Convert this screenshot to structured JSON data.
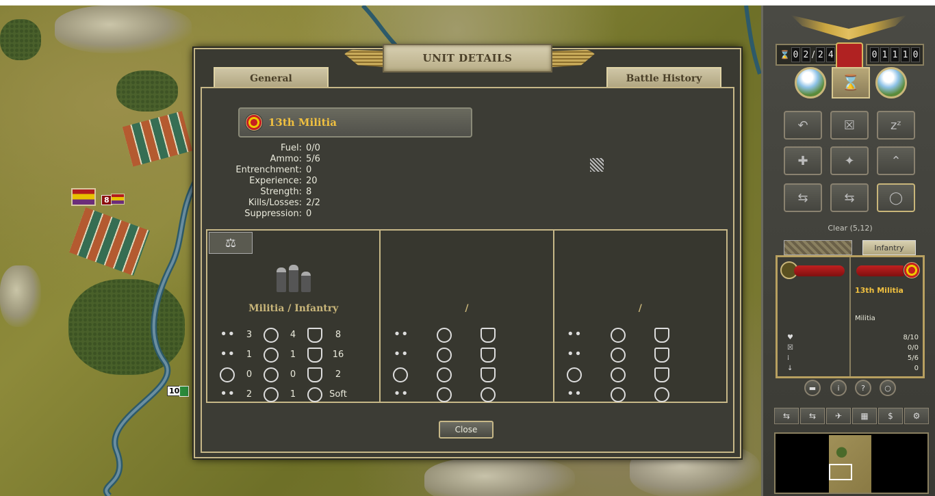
{
  "map": {
    "units": [
      {
        "strength": "8"
      },
      {
        "strength": "10"
      }
    ]
  },
  "dialog": {
    "title": "UNIT DETAILS",
    "tabs": [
      {
        "label": "General"
      },
      {
        "label": "Battle History"
      }
    ],
    "unit": {
      "name": "13th Militia",
      "stats": [
        {
          "label": "Fuel:",
          "value": "0/0"
        },
        {
          "label": "Ammo:",
          "value": "5/6"
        },
        {
          "label": "Entrenchment:",
          "value": "0"
        },
        {
          "label": "Experience:",
          "value": "20"
        },
        {
          "label": "Strength:",
          "value": "8"
        },
        {
          "label": "Kills/Losses:",
          "value": "2/2"
        },
        {
          "label": "Suppression:",
          "value": "0"
        }
      ]
    },
    "panels": [
      {
        "type_label": "Militia / Infantry",
        "rows": [
          {
            "a": "3",
            "b": "4",
            "c": "8"
          },
          {
            "a": "1",
            "b": "1",
            "c": "16"
          },
          {
            "a": "0",
            "b": "0",
            "c": "2"
          },
          {
            "a": "2",
            "b": "1",
            "c": "Soft"
          }
        ]
      },
      {
        "type_label": "/",
        "rows": [
          {
            "a": "",
            "b": "",
            "c": ""
          },
          {
            "a": "",
            "b": "",
            "c": ""
          },
          {
            "a": "",
            "b": "",
            "c": ""
          },
          {
            "a": "",
            "b": "",
            "c": ""
          }
        ]
      },
      {
        "type_label": "/",
        "rows": [
          {
            "a": "",
            "b": "",
            "c": ""
          },
          {
            "a": "",
            "b": "",
            "c": ""
          },
          {
            "a": "",
            "b": "",
            "c": ""
          },
          {
            "a": "",
            "b": "",
            "c": ""
          }
        ]
      }
    ],
    "close_label": "Close"
  },
  "side": {
    "turn": {
      "current": [
        "0",
        "2"
      ],
      "total": [
        "2",
        "4"
      ]
    },
    "score": [
      "0",
      "1",
      "1",
      "1",
      "0"
    ],
    "terrain_label": "Clear (5,12)",
    "tab_right_label": "Infantry",
    "card": {
      "name": "13th Militia",
      "class": "Militia",
      "stats": [
        "8/10",
        "0/0",
        "5/6",
        "0"
      ]
    }
  },
  "colors": {
    "accent_gold": "#c7b888",
    "name_gold": "#f0c040",
    "panel_bg": "#3a3a32"
  }
}
